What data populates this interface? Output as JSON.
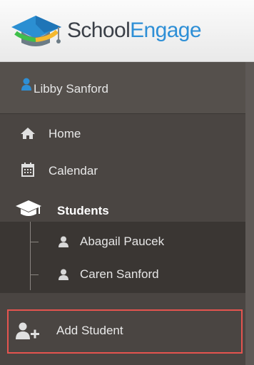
{
  "brand": {
    "part1": "School",
    "part2": "Engage"
  },
  "user": {
    "name": "Libby Sanford"
  },
  "nav": {
    "home": "Home",
    "calendar": "Calendar",
    "students": "Students"
  },
  "students": [
    {
      "name": "Abagail Paucek"
    },
    {
      "name": "Caren Sanford"
    }
  ],
  "actions": {
    "add_student": "Add Student"
  },
  "colors": {
    "accent": "#2e8fd6",
    "highlight_border": "#e5544f",
    "sidebar_bg": "#4a4542"
  },
  "icons": {
    "logo": "graduation-cap-logo-icon",
    "user": "user-icon",
    "home": "home-icon",
    "calendar": "calendar-icon",
    "students": "graduation-cap-icon",
    "student": "user-icon",
    "add_student": "add-user-icon"
  }
}
